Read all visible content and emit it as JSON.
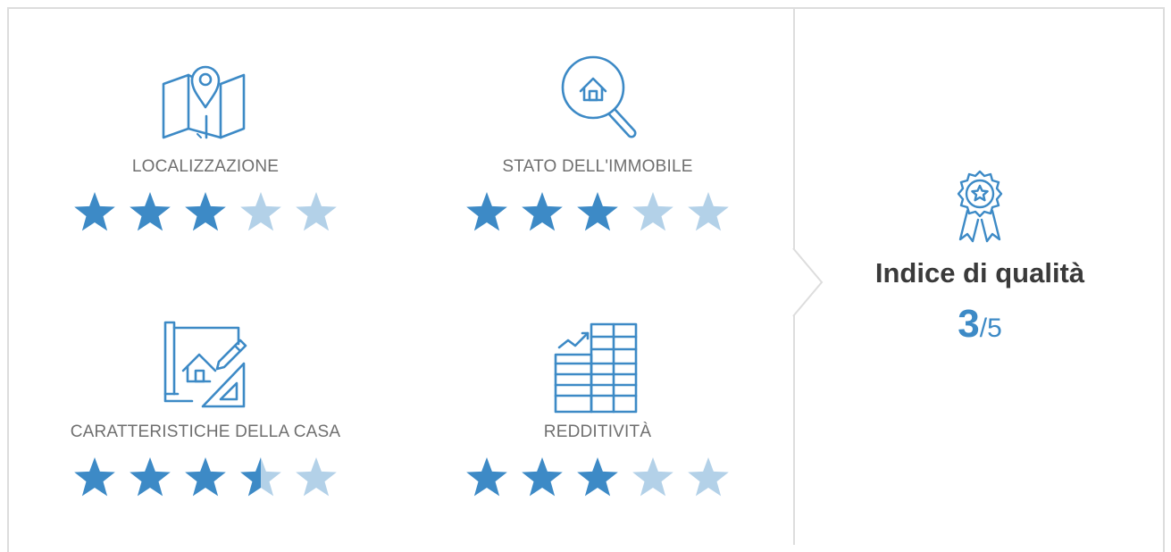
{
  "colors": {
    "accent": "#3d8ac6",
    "star_filled": "#3d8ac6",
    "star_empty": "#b3d1e8",
    "label": "#6f6f6f",
    "title": "#3a3a3a",
    "border": "#dddddd"
  },
  "criteria": [
    {
      "label": "LOCALIZZAZIONE",
      "icon": "map-pin-icon",
      "rating": 3,
      "max": 5
    },
    {
      "label": "STATO DELL'IMMOBILE",
      "icon": "house-magnifier-icon",
      "rating": 3,
      "max": 5
    },
    {
      "label": "CARATTERISTICHE DELLA CASA",
      "icon": "blueprint-house-icon",
      "rating": 3.5,
      "max": 5
    },
    {
      "label": "REDDITIVITÀ",
      "icon": "growth-chart-icon",
      "rating": 3,
      "max": 5
    }
  ],
  "summary": {
    "icon": "award-badge-icon",
    "title": "Indice di qualità",
    "score": "3",
    "separator": "/",
    "max": "5"
  }
}
